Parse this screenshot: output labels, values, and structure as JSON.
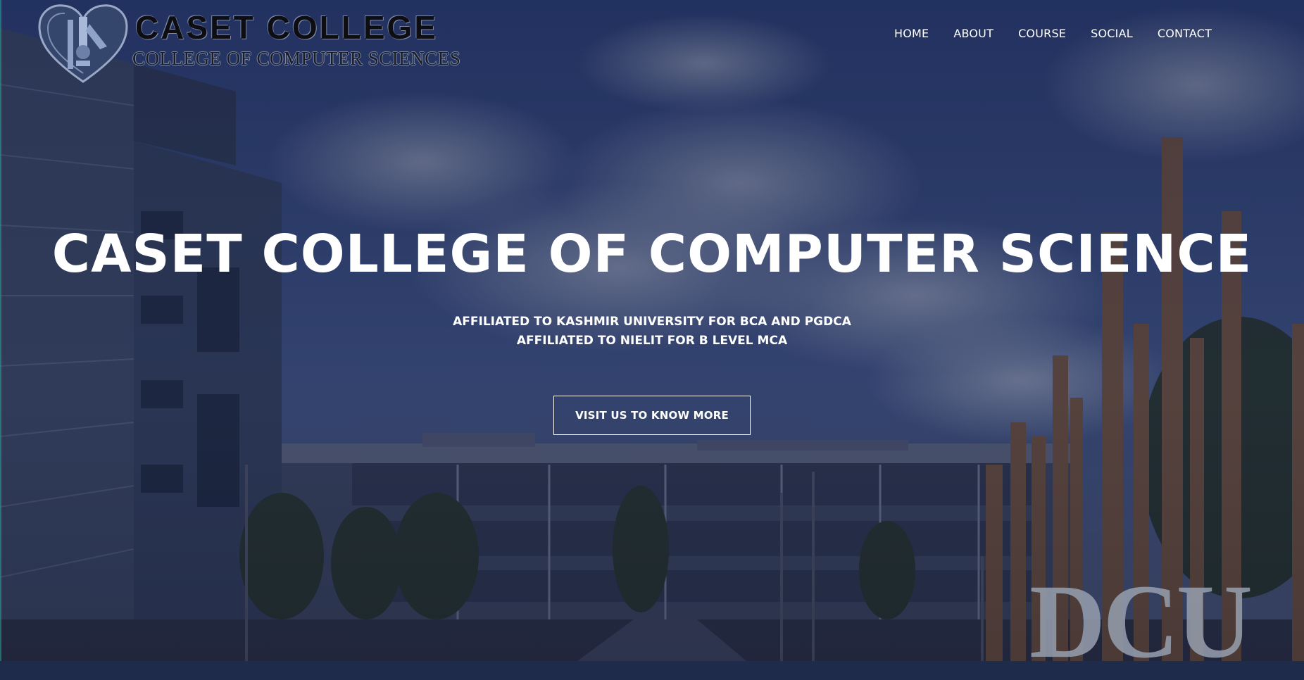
{
  "logo": {
    "title": "CASET COLLEGE",
    "subtitle": "COLLEGE OF COMPUTER SCIENCES",
    "emblem_icon": "heart-crest-icon"
  },
  "nav": {
    "items": [
      {
        "label": "HOME"
      },
      {
        "label": "ABOUT"
      },
      {
        "label": "COURSE"
      },
      {
        "label": "SOCIAL"
      },
      {
        "label": "CONTACT"
      }
    ]
  },
  "hero": {
    "title": "CASET COLLEGE OF COMPUTER SCIENCE",
    "line1": "AFFILIATED TO KASHMIR UNIVERSITY FOR BCA AND PGDCA",
    "line2": "AFFILIATED TO NIELIT FOR B LEVEL MCA",
    "cta_label": "VISIT US TO KNOW MORE"
  },
  "background": {
    "sign_text": "DCU"
  },
  "colors": {
    "overlay": "#1f2b4a",
    "text": "#ffffff",
    "accent": "#2a9d8f"
  }
}
